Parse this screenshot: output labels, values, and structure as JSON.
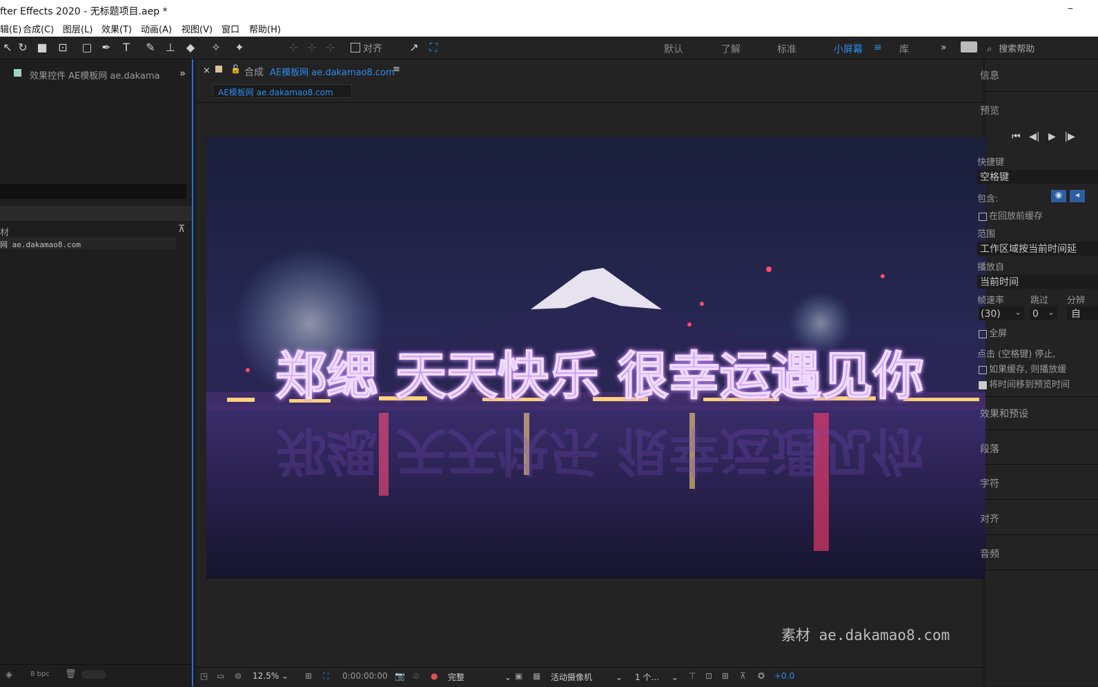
{
  "window": {
    "title": "fter Effects 2020 - 无标题项目.aep *",
    "minimize": "–"
  },
  "menu": [
    "辑(E)",
    "合成(C)",
    "图层(L)",
    "效果(T)",
    "动画(A)",
    "视图(V)",
    "窗口",
    "帮助(H)"
  ],
  "toolbar": {
    "align_label": "对齐",
    "workspaces": [
      "默认",
      "了解",
      "标准",
      "小屏幕",
      "库"
    ],
    "active_workspace": "小屏幕",
    "overflow": "»",
    "search_placeholder": "搜索帮助"
  },
  "left": {
    "effect_controls_tab": "效果控件 AE模板网 ae.dakama",
    "overflow": "»",
    "project_header": "材",
    "project_item": "网 ae.dakamao8.com",
    "bit_depth": "8 bpc"
  },
  "comp": {
    "tab_title_prefix": "合成",
    "tab_title_name": "AE模板网 ae.dakamao8.com",
    "menu_icon": "≡",
    "close": "×",
    "breadcrumb": "AE模板网 ae.dakamao8.com",
    "overlay_text": "郑缌  天天快乐  很幸运遇见你",
    "watermark": "素材 ae.dakamao8.com",
    "zoom": "12.5%",
    "timecode": "0:00:00:00",
    "resolution": "完整",
    "camera": "活动摄像机",
    "views": "1 个...",
    "exposure": "+0.0"
  },
  "right": {
    "info_label": "信息",
    "preview_label": "预览",
    "shortcut_label": "快捷键",
    "shortcut_value": "空格键",
    "include_label": "包含:",
    "cache_label": "在回放前缓存",
    "range_label": "范围",
    "range_value": "工作区域按当前时间延",
    "play_from_label": "播放自",
    "play_from_value": "当前时间",
    "fps_label": "帧速率",
    "skip_label": "跳过",
    "res_label": "分辨",
    "fps_value": "(30)",
    "skip_value": "0",
    "res_value": "自",
    "fullscreen_label": "全屏",
    "stop_label": "点击 (空格键) 停止,",
    "if_cached_label": "如果缓存, 则播放缓",
    "move_time_label": "将时间移到预览时间",
    "effects_presets": "效果和预设",
    "paragraph": "段落",
    "character": "字符",
    "align": "对齐",
    "audio": "音频"
  },
  "colors": {
    "accent": "#2d8ceb",
    "panel_border": "#2d6fd0",
    "neon": "#b35cff"
  }
}
